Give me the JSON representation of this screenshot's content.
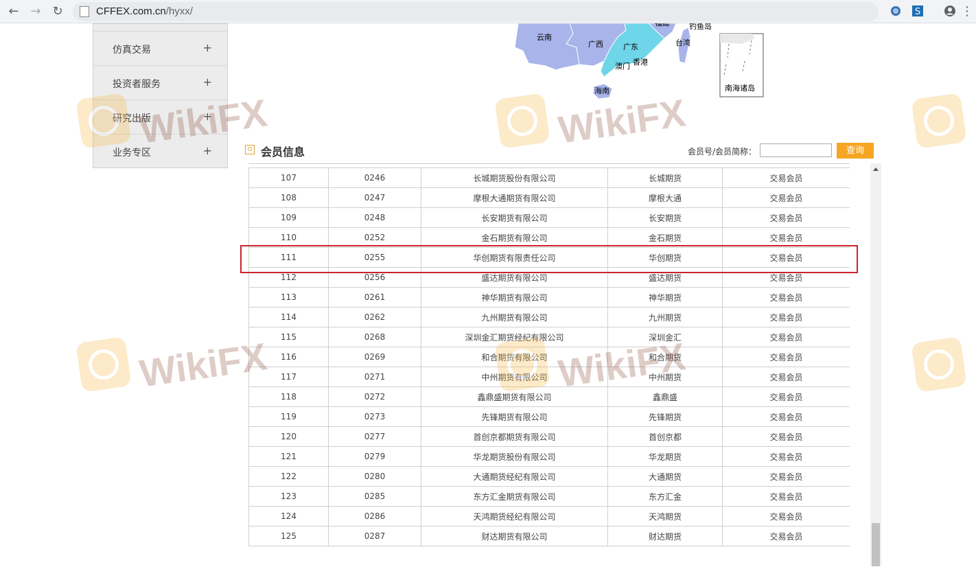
{
  "browser": {
    "url_host": "CFFEX.com.cn",
    "url_path": "/hyxx/"
  },
  "sidebar": {
    "items": [
      {
        "label": "仿真交易",
        "plus": "+"
      },
      {
        "label": "投资者服务",
        "plus": "+"
      },
      {
        "label": "研究出版",
        "plus": "+"
      },
      {
        "label": "业务专区",
        "plus": "+"
      }
    ]
  },
  "map": {
    "labels": [
      "云南",
      "广西",
      "广东",
      "澳门",
      "香港",
      "海南",
      "台湾",
      "钓鱼岛",
      "南海诸岛",
      "福建"
    ]
  },
  "member": {
    "title": "会员信息",
    "search_label": "会员号/会员简称：",
    "search_value": "",
    "search_button": "查询"
  },
  "table": {
    "rows": [
      [
        "107",
        "0246",
        "长城期货股份有限公司",
        "长城期货",
        "交易会员"
      ],
      [
        "108",
        "0247",
        "摩根大通期货有限公司",
        "摩根大通",
        "交易会员"
      ],
      [
        "109",
        "0248",
        "长安期货有限公司",
        "长安期货",
        "交易会员"
      ],
      [
        "110",
        "0252",
        "金石期货有限公司",
        "金石期货",
        "交易会员"
      ],
      [
        "111",
        "0255",
        "华创期货有限责任公司",
        "华创期货",
        "交易会员"
      ],
      [
        "112",
        "0256",
        "盛达期货有限公司",
        "盛达期货",
        "交易会员"
      ],
      [
        "113",
        "0261",
        "神华期货有限公司",
        "神华期货",
        "交易会员"
      ],
      [
        "114",
        "0262",
        "九州期货有限公司",
        "九州期货",
        "交易会员"
      ],
      [
        "115",
        "0268",
        "深圳金汇期货经纪有限公司",
        "深圳金汇",
        "交易会员"
      ],
      [
        "116",
        "0269",
        "和合期货有限公司",
        "和合期货",
        "交易会员"
      ],
      [
        "117",
        "0271",
        "中州期货有限公司",
        "中州期货",
        "交易会员"
      ],
      [
        "118",
        "0272",
        "鑫鼎盛期货有限公司",
        "鑫鼎盛",
        "交易会员"
      ],
      [
        "119",
        "0273",
        "先锋期货有限公司",
        "先锋期货",
        "交易会员"
      ],
      [
        "120",
        "0277",
        "首创京都期货有限公司",
        "首创京都",
        "交易会员"
      ],
      [
        "121",
        "0279",
        "华龙期货股份有限公司",
        "华龙期货",
        "交易会员"
      ],
      [
        "122",
        "0280",
        "大通期货经纪有限公司",
        "大通期货",
        "交易会员"
      ],
      [
        "123",
        "0285",
        "东方汇金期货有限公司",
        "东方汇金",
        "交易会员"
      ],
      [
        "124",
        "0286",
        "天鸿期货经纪有限公司",
        "天鸿期货",
        "交易会员"
      ],
      [
        "125",
        "0287",
        "财达期货有限公司",
        "财达期货",
        "交易会员"
      ]
    ]
  },
  "watermark": {
    "text": "WikiFX"
  },
  "colors": {
    "accent": "#f6a623",
    "highlight": "#c9232b"
  }
}
